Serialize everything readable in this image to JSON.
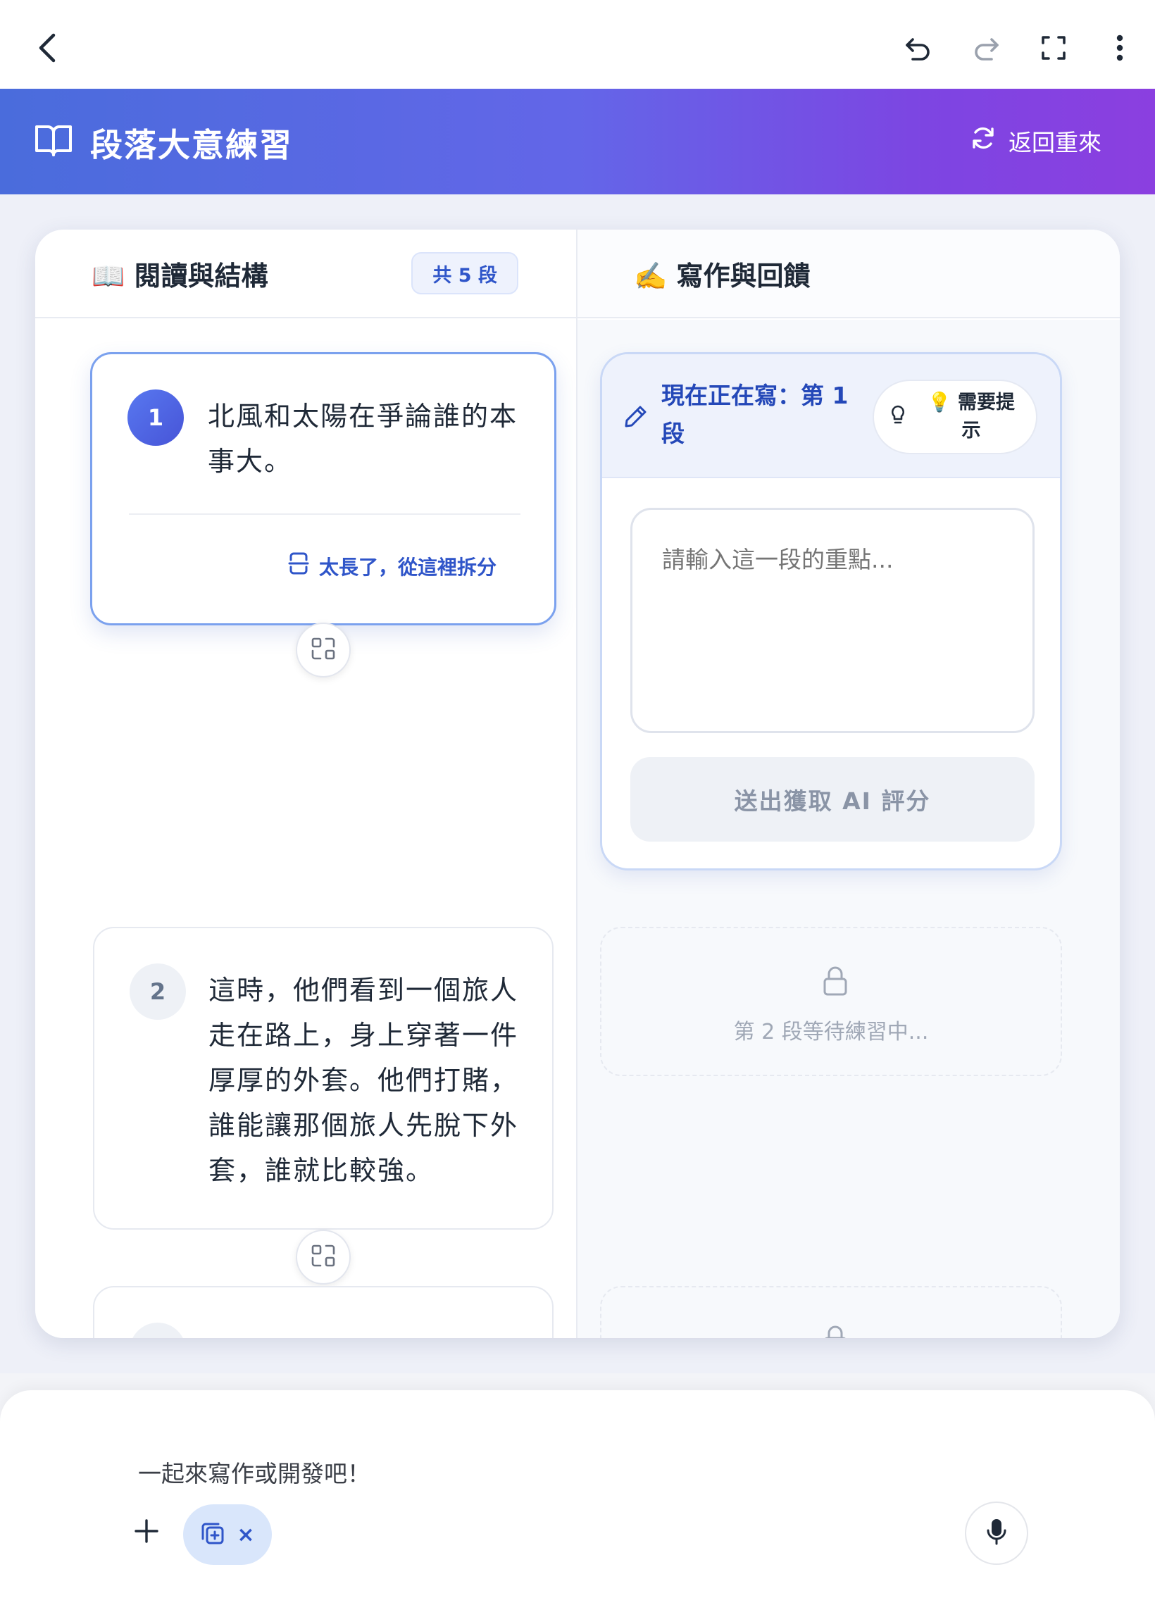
{
  "browser_bar": {
    "icons": [
      "back-icon",
      "undo-icon",
      "redo-icon",
      "fullscreen-icon",
      "more-icon"
    ]
  },
  "header": {
    "title": "段落大意練習",
    "reset_label": "返回重來",
    "colors": {
      "gradient_start": "#4a6cdc",
      "gradient_end": "#8b3fe0"
    }
  },
  "left_column": {
    "title": "📖 閱讀與結構",
    "count_badge": "共 5 段",
    "paragraphs": [
      {
        "number": "1",
        "text": "北風和太陽在爭論誰的本事大。",
        "split_label": "太長了，從這裡拆分"
      },
      {
        "number": "2",
        "text": "這時，他們看到一個旅人走在路上，身上穿著一件厚厚的外套。他們打賭，誰能讓那個旅人先脫下外套，誰就比較強。"
      }
    ]
  },
  "right_column": {
    "title": "✍️ 寫作與回饋",
    "current": {
      "title": "現在正在寫：第 1 段",
      "hint_label": "💡 需要提示",
      "input_placeholder": "請輸入這一段的重點...",
      "input_value": "",
      "submit_label": "送出獲取 AI 評分"
    },
    "locked": [
      {
        "text": "第 2 段等待練習中..."
      }
    ]
  },
  "composer": {
    "prompt": "一起來寫作或開發吧！",
    "chip_close": "×"
  }
}
